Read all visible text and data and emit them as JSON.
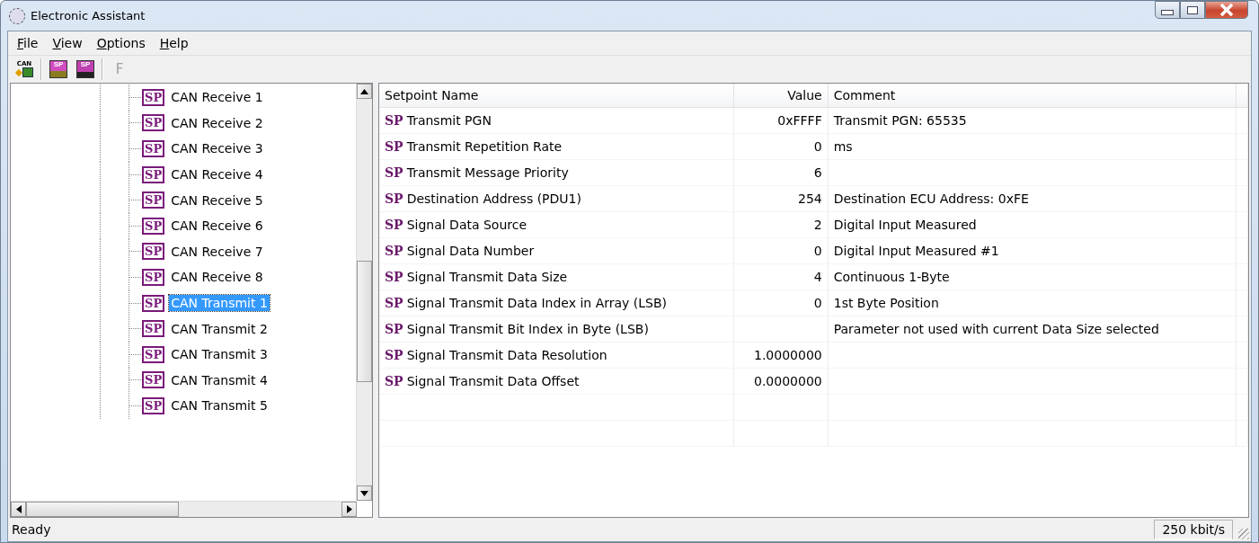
{
  "window": {
    "title": "Electronic Assistant"
  },
  "menu": [
    "File",
    "View",
    "Options",
    "Help"
  ],
  "toolbar": [
    {
      "kind": "connect",
      "label": "CAN"
    },
    {
      "kind": "open",
      "label": "SP"
    },
    {
      "kind": "save",
      "label": "SP"
    },
    {
      "kind": "letter",
      "label": "F",
      "disabled": true
    }
  ],
  "tree": {
    "items": [
      {
        "badge": "SP",
        "label": "CAN Receive 1",
        "selected": false
      },
      {
        "badge": "SP",
        "label": "CAN Receive 2",
        "selected": false
      },
      {
        "badge": "SP",
        "label": "CAN Receive 3",
        "selected": false
      },
      {
        "badge": "SP",
        "label": "CAN Receive 4",
        "selected": false
      },
      {
        "badge": "SP",
        "label": "CAN Receive 5",
        "selected": false
      },
      {
        "badge": "SP",
        "label": "CAN Receive 6",
        "selected": false
      },
      {
        "badge": "SP",
        "label": "CAN Receive 7",
        "selected": false
      },
      {
        "badge": "SP",
        "label": "CAN Receive 8",
        "selected": false
      },
      {
        "badge": "SP",
        "label": "CAN Transmit 1",
        "selected": true
      },
      {
        "badge": "SP",
        "label": "CAN Transmit 2",
        "selected": false
      },
      {
        "badge": "SP",
        "label": "CAN Transmit 3",
        "selected": false
      },
      {
        "badge": "SP",
        "label": "CAN Transmit 4",
        "selected": false
      },
      {
        "badge": "SP",
        "label": "CAN Transmit 5",
        "selected": false
      }
    ]
  },
  "table": {
    "columns": [
      "Setpoint Name",
      "Value",
      "Comment"
    ],
    "rows": [
      {
        "badge": "SP",
        "name": "Transmit PGN",
        "value": "0xFFFF",
        "comment": "Transmit PGN: 65535"
      },
      {
        "badge": "SP",
        "name": "Transmit Repetition Rate",
        "value": "0",
        "comment": "ms"
      },
      {
        "badge": "SP",
        "name": "Transmit Message Priority",
        "value": "6"
      },
      {
        "badge": "SP",
        "name": "Destination Address (PDU1)",
        "value": "254",
        "comment": "Destination ECU Address: 0xFE"
      },
      {
        "badge": "SP",
        "name": "Signal Data Source",
        "value": "2",
        "comment": "Digital Input Measured"
      },
      {
        "badge": "SP",
        "name": "Signal Data Number",
        "value": "0",
        "comment": "Digital Input Measured #1"
      },
      {
        "badge": "SP",
        "name": "Signal Transmit Data Size",
        "value": "4",
        "comment": "Continuous 1-Byte"
      },
      {
        "badge": "SP",
        "name": "Signal Transmit Data Index in Array (LSB)",
        "value": "0",
        "comment": "1st Byte Position"
      },
      {
        "badge": "SP",
        "name": "Signal Transmit Bit Index in Byte (LSB)",
        "comment": "Parameter not used with current Data Size selected"
      },
      {
        "badge": "SP",
        "name": "Signal Transmit Data Resolution",
        "value": "1.0000000"
      },
      {
        "badge": "SP",
        "name": "Signal Transmit Data Offset",
        "value": "0.0000000"
      }
    ]
  },
  "status_bar": {
    "message": "Ready",
    "baud": "250 kbit/s"
  }
}
